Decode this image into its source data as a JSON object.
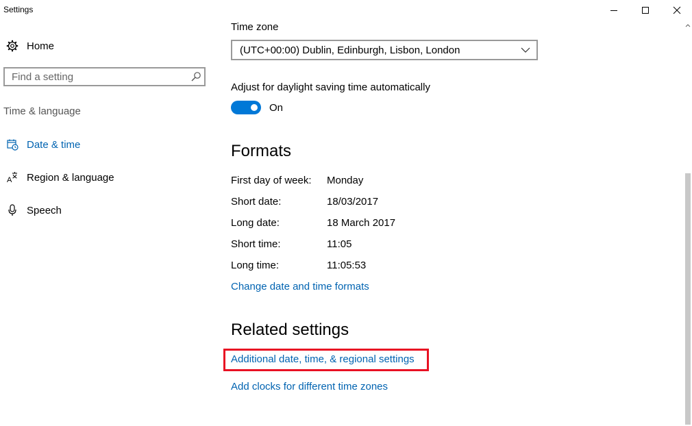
{
  "window": {
    "title": "Settings",
    "controls": [
      "minimize",
      "maximize",
      "close"
    ]
  },
  "sidebar": {
    "home_label": "Home",
    "search_placeholder": "Find a setting",
    "section_heading": "Time & language",
    "items": [
      {
        "label": "Date & time",
        "icon": "calendar-clock-icon",
        "active": true
      },
      {
        "label": "Region & language",
        "icon": "language-icon",
        "active": false
      },
      {
        "label": "Speech",
        "icon": "microphone-icon",
        "active": false
      }
    ]
  },
  "main": {
    "timezone": {
      "label": "Time zone",
      "value": "(UTC+00:00) Dublin, Edinburgh, Lisbon, London"
    },
    "daylight": {
      "label": "Adjust for daylight saving time automatically",
      "state": "On"
    },
    "formats": {
      "heading": "Formats",
      "rows": [
        {
          "label": "First day of week:",
          "value": "Monday"
        },
        {
          "label": "Short date:",
          "value": "18/03/2017"
        },
        {
          "label": "Long date:",
          "value": "18 March 2017"
        },
        {
          "label": "Short time:",
          "value": "11:05"
        },
        {
          "label": "Long time:",
          "value": "11:05:53"
        }
      ],
      "change_link": "Change date and time formats"
    },
    "related": {
      "heading": "Related settings",
      "links": [
        "Additional date, time, & regional settings",
        "Add clocks for different time zones"
      ]
    }
  },
  "colors": {
    "accent": "#0078d7",
    "link": "#0063b1",
    "highlight": "#e81123"
  }
}
